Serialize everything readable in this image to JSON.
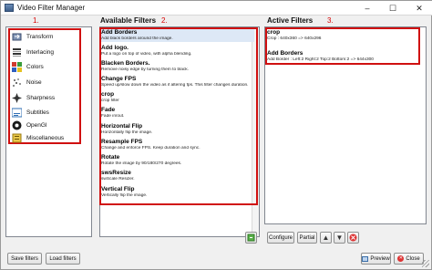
{
  "window": {
    "title": "Video Filter Manager",
    "controls": {
      "minimize": "–",
      "maximize": "☐",
      "close": "✕"
    }
  },
  "annotations": {
    "one": "1.",
    "two": "2.",
    "three": "3."
  },
  "available_heading": "Available Filters",
  "active_heading": "Active Filters",
  "categories": [
    {
      "label": "Transform",
      "icon": "transform-icon",
      "color": "#5a6b8a"
    },
    {
      "label": "Interlacing",
      "icon": "interlacing-icon",
      "color": "#444444"
    },
    {
      "label": "Colors",
      "icon": "colors-icon",
      "color": "#d04a3a"
    },
    {
      "label": "Noise",
      "icon": "noise-icon",
      "color": "#7a7a7a"
    },
    {
      "label": "Sharpness",
      "icon": "sharpness-icon",
      "color": "#3a3a3a"
    },
    {
      "label": "Subtitles",
      "icon": "subtitles-icon",
      "color": "#2f6fb5"
    },
    {
      "label": "OpenGl",
      "icon": "opengl-icon",
      "color": "#1a1a1a"
    },
    {
      "label": "Miscellaneous",
      "icon": "miscellaneous-icon",
      "color": "#c9a227"
    }
  ],
  "available_filters": [
    {
      "name": "Add Borders",
      "desc": "Add black borders around the image."
    },
    {
      "name": "Add logo.",
      "desc": "Put a logo on top of video, with alpha blending."
    },
    {
      "name": "Blacken Borders.",
      "desc": "Remove noisy edge by turning them to black."
    },
    {
      "name": "Change FPS",
      "desc": "Speed up/slow down the video as if altering fps. This filter changes duration."
    },
    {
      "name": "crop",
      "desc": "crop filter"
    },
    {
      "name": "Fade",
      "desc": "Fade in/out."
    },
    {
      "name": "Horizontal Flip",
      "desc": "Horizontally flip the image."
    },
    {
      "name": "Resample FPS",
      "desc": "Change and enforce FPS. Keep duration and sync."
    },
    {
      "name": "Rotate",
      "desc": "Rotate the image by 90/180/270 degrees."
    },
    {
      "name": "swsResize",
      "desc": "swScale Resizer."
    },
    {
      "name": "Vertical Flip",
      "desc": "Vertically flip the image."
    }
  ],
  "active_filters": [
    {
      "name": "crop",
      "desc": "Crop : 640x360 => 640x296"
    },
    {
      "name": "Add Borders",
      "desc": "Add Border : Left:2 Right:2 Top:2 Bottom:2 => 644x300"
    }
  ],
  "buttons": {
    "configure": "Configure",
    "partial": "Partial",
    "save_filters": "Save filters",
    "load_filters": "Load filters",
    "preview": "Preview",
    "close": "Close"
  },
  "colors": {
    "annotation_red": "#d01010",
    "selection": "#dde8f6"
  }
}
